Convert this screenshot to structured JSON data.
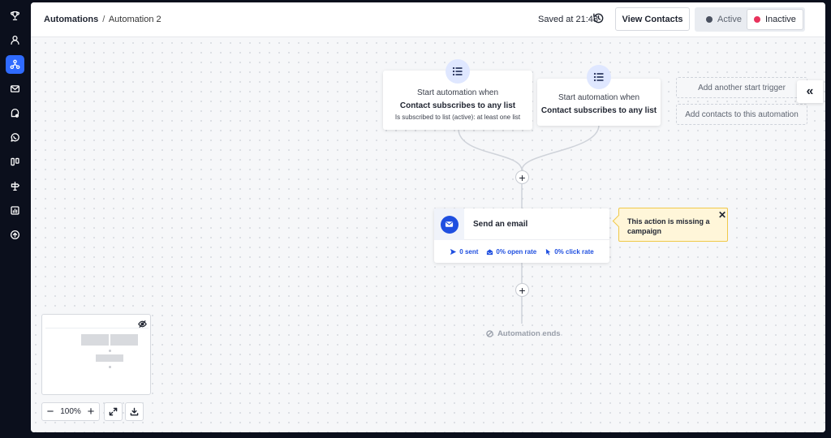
{
  "breadcrumb": {
    "root": "Automations",
    "separator": "/",
    "current": "Automation 2"
  },
  "header": {
    "saved_text": "Saved at 21:48",
    "view_contacts_label": "View Contacts",
    "status": {
      "active_label": "Active",
      "inactive_label": "Inactive",
      "selected": "Inactive",
      "active_dot_color": "#4a5160",
      "inactive_dot_color": "#e8325c"
    }
  },
  "sidebar": {
    "items": [
      {
        "icon": "trophy-icon",
        "active": false
      },
      {
        "icon": "user-icon",
        "active": false
      },
      {
        "icon": "automation-icon",
        "active": true
      },
      {
        "icon": "mail-icon",
        "active": false
      },
      {
        "icon": "chat-icon",
        "active": false
      },
      {
        "icon": "whatsapp-icon",
        "active": false
      },
      {
        "icon": "pipeline-icon",
        "active": false
      },
      {
        "icon": "signpost-icon",
        "active": false
      },
      {
        "icon": "reports-icon",
        "active": false
      },
      {
        "icon": "upgrade-icon",
        "active": false
      }
    ]
  },
  "triggers": [
    {
      "title": "Start automation when",
      "event": "Contact subscribes to any list",
      "condition": "Is subscribed to list (active): at least one list",
      "icon": "list-icon"
    },
    {
      "title": "Start automation when",
      "event": "Contact subscribes to any list",
      "condition": "",
      "icon": "list-icon"
    }
  ],
  "side_actions": {
    "add_trigger_label": "Add another start trigger",
    "add_contacts_label": "Add contacts to this automation"
  },
  "action": {
    "title": "Send an email",
    "icon": "mail-icon",
    "stats": {
      "sent": "0 sent",
      "open_rate": "0% open rate",
      "click_rate": "0% click rate"
    }
  },
  "warning": {
    "text": "This action is missing a campaign"
  },
  "end_label": "Automation ends",
  "zoom": {
    "level": "100%"
  },
  "colors": {
    "accent": "#1f4fe0",
    "sidebar_bg": "#0b0f1c",
    "nav_active": "#2f6bff",
    "warning_bg": "#fff6d9",
    "warning_border": "#f0c94a"
  }
}
